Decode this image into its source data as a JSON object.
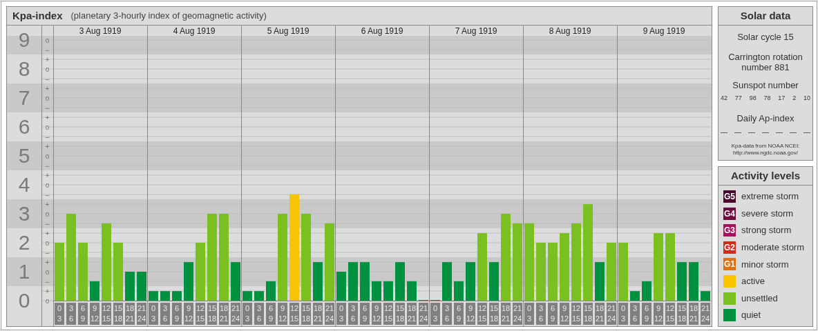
{
  "title": {
    "name": "Kpa-index",
    "subtitle": "(planetary 3-hourly index of geomagnetic activity)"
  },
  "chart": {
    "days": [
      "3 Aug 1919",
      "4 Aug 1919",
      "5 Aug 1919",
      "6 Aug 1919",
      "7 Aug 1919",
      "8 Aug 1919",
      "9 Aug 1919"
    ],
    "chart_data": {
      "type": "bar",
      "stacked": true,
      "ylim": [
        0,
        9.5
      ],
      "grid": true,
      "yticks": [
        0,
        1,
        2,
        3,
        4,
        5,
        6,
        7,
        8,
        9
      ],
      "annotations": [
        "o",
        "+",
        "–",
        "o",
        "+",
        "–",
        "o",
        "+",
        "–",
        "o",
        "+",
        "–",
        "o",
        "+",
        "–",
        "o",
        "+",
        "–",
        "o",
        "+",
        "–",
        "o",
        "+",
        "–",
        "o",
        "+",
        "–",
        "o"
      ],
      "categories": [
        "0 3",
        "3 6",
        "6 9",
        "9 12",
        "12 15",
        "15 18",
        "18 21",
        "21 24",
        "0 3",
        "3 6",
        "6 9",
        "9 12",
        "12 15",
        "15 18",
        "18 21",
        "21 24",
        "0 3",
        "3 6",
        "6 9",
        "9 12",
        "12 15",
        "15 18",
        "18 21",
        "21 24",
        "0 3",
        "3 6",
        "6 9",
        "9 12",
        "12 15",
        "15 18",
        "18 21",
        "21 24",
        "0 3",
        "3 6",
        "6 9",
        "9 12",
        "12 15",
        "15 18",
        "18 21",
        "21 24",
        "0 3",
        "3 6",
        "6 9",
        "9 12",
        "12 15",
        "15 18",
        "18 21",
        "21 24",
        "0 3",
        "3 6",
        "6 9",
        "9 12",
        "12 15",
        "15 18",
        "18 21",
        "21 24"
      ],
      "series": [
        {
          "name": "quiet",
          "color": "#009140",
          "values": [
            null,
            null,
            null,
            0.67,
            null,
            null,
            1,
            1,
            0.33,
            0.33,
            0.33,
            1.33,
            null,
            null,
            null,
            1.33,
            0.33,
            0.33,
            0.67,
            null,
            null,
            null,
            1.33,
            null,
            1,
            1.33,
            1.33,
            0.67,
            0.67,
            1.33,
            0.67,
            0,
            0,
            1.33,
            0.67,
            1.33,
            null,
            1.33,
            null,
            null,
            null,
            null,
            null,
            null,
            null,
            null,
            1.33,
            null,
            null,
            0.33,
            0.67,
            null,
            null,
            1.33,
            1.33,
            0.33
          ]
        },
        {
          "name": "unsettled",
          "color": "#7bc021",
          "values": [
            2,
            3,
            2,
            null,
            2.67,
            2,
            null,
            null,
            null,
            null,
            null,
            null,
            2,
            3,
            3,
            null,
            null,
            null,
            null,
            3,
            null,
            3,
            null,
            2.67,
            null,
            null,
            null,
            null,
            null,
            null,
            null,
            null,
            null,
            null,
            null,
            null,
            2.33,
            null,
            3,
            2.67,
            2.67,
            2,
            2,
            2.33,
            2.67,
            3.33,
            null,
            2,
            2,
            null,
            null,
            2.33,
            2.33,
            null,
            null,
            null
          ]
        },
        {
          "name": "active",
          "color": "#f8c400",
          "values": [
            null,
            null,
            null,
            null,
            null,
            null,
            null,
            null,
            null,
            null,
            null,
            null,
            null,
            null,
            null,
            null,
            null,
            null,
            null,
            null,
            3.67,
            null,
            null,
            null,
            null,
            null,
            null,
            null,
            null,
            null,
            null,
            null,
            null,
            null,
            null,
            null,
            null,
            null,
            null,
            null,
            null,
            null,
            null,
            null,
            null,
            null,
            null,
            null,
            null,
            null,
            null,
            null,
            null,
            null,
            null,
            null
          ]
        }
      ]
    }
  },
  "solar_data": {
    "title": "Solar data",
    "solar_cycle": "Solar cycle 15",
    "carrington": "Carrington rotation number 881",
    "sunspot_title": "Sunspot number",
    "sunspot_numbers": [
      "42",
      "77",
      "98",
      "78",
      "17",
      "2",
      "10"
    ],
    "ap_title": "Daily Ap-index",
    "ap_values": [
      "—",
      "—",
      "—",
      "—",
      "—",
      "—",
      "—"
    ],
    "source": "Kpa-data from NOAA NCEI:",
    "source_url": "http://www.ngdc.noaa.gov/"
  },
  "activity_levels": {
    "title": "Activity levels",
    "items": [
      {
        "badge": "G5",
        "label": "extreme storm",
        "color": "#4a0a2c"
      },
      {
        "badge": "G4",
        "label": "severe storm",
        "color": "#6e0a3e"
      },
      {
        "badge": "G3",
        "label": "strong storm",
        "color": "#a8105e"
      },
      {
        "badge": "G2",
        "label": "moderate storm",
        "color": "#d42a1a"
      },
      {
        "badge": "G1",
        "label": "minor storm",
        "color": "#e07010"
      }
    ]
  }
}
